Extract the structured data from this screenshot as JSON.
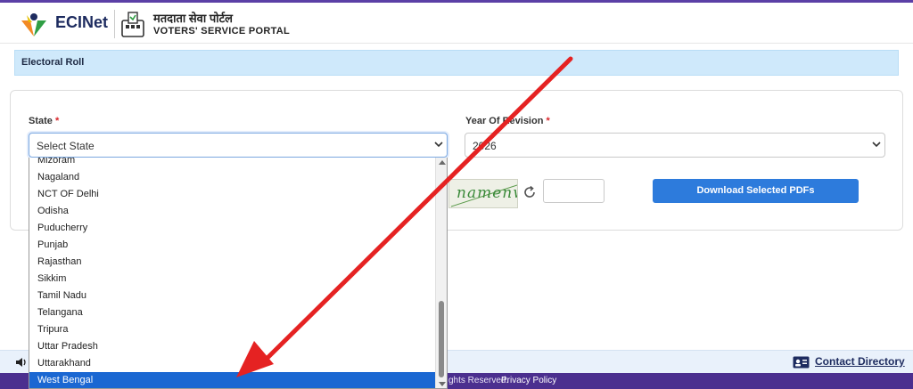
{
  "header": {
    "logo_text": "ECINet",
    "portal_hindi": "मतदाता सेवा पोर्टल",
    "portal_english": "VOTERS' SERVICE PORTAL"
  },
  "section": {
    "title": "Electoral Roll"
  },
  "form": {
    "state_label": "State",
    "required_mark": "*",
    "state_value": "Select State",
    "year_label": "Year Of Revision",
    "year_value": "2026",
    "captcha_text": "namenw",
    "captcha_input_value": "",
    "download_label": "Download Selected PDFs"
  },
  "dropdown": {
    "options": [
      "Mizoram",
      "Nagaland",
      "NCT OF Delhi",
      "Odisha",
      "Puducherry",
      "Punjab",
      "Rajasthan",
      "Sikkim",
      "Tamil Nadu",
      "Telangana",
      "Tripura",
      "Uttar Pradesh",
      "Uttarakhand",
      "West Bengal"
    ],
    "highlighted": "West Bengal",
    "scroll_position": 0.62
  },
  "strip": {
    "contact_label": "Contact Directory"
  },
  "footer": {
    "rights_text": "ghts Reserved.",
    "privacy_label": "Privacy Policy"
  },
  "colors": {
    "brand_purple": "#4b2f8f",
    "primary_blue": "#2d7bdc",
    "highlight_blue": "#1a67d2",
    "annotation_red": "#e52222"
  }
}
